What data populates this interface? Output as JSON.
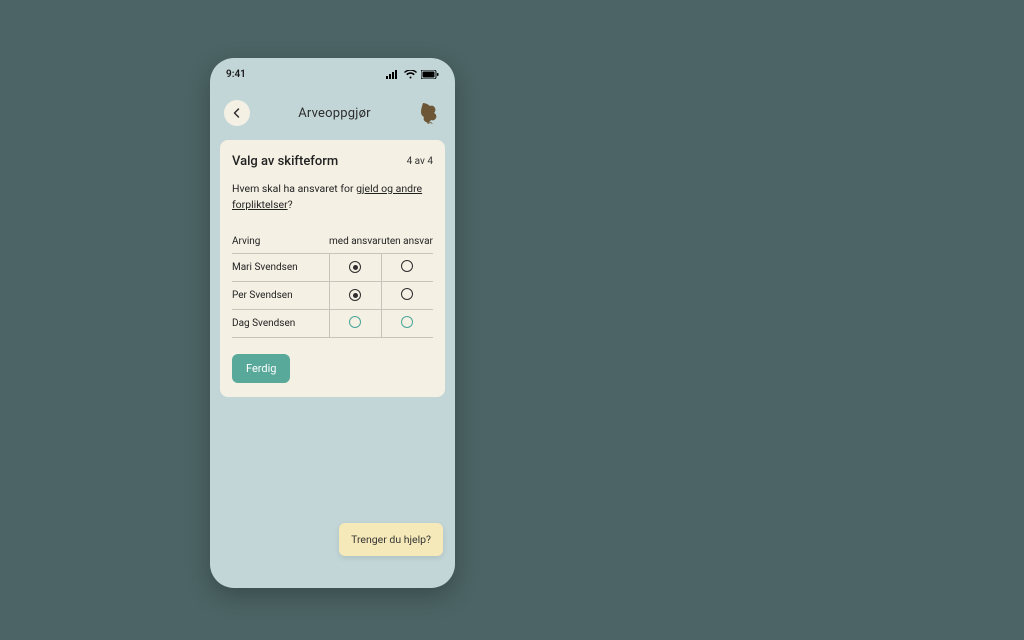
{
  "status": {
    "time": "9:41"
  },
  "header": {
    "title": "Arveoppgjør"
  },
  "card": {
    "title": "Valg av skifteform",
    "step": "4 av 4",
    "question_prefix": "Hvem skal ha ansvaret for ",
    "question_link": "gjeld og andre forpliktelser",
    "question_suffix": "?",
    "col_heir": "Arving",
    "col_with": "med ansvar",
    "col_without": "uten ansvar",
    "rows": [
      {
        "name": "Mari Svendsen",
        "with": true,
        "without": false,
        "teal": false
      },
      {
        "name": "Per Svendsen",
        "with": true,
        "without": false,
        "teal": false
      },
      {
        "name": "Dag Svendsen",
        "with": false,
        "without": false,
        "teal": true
      }
    ],
    "done": "Ferdig"
  },
  "help": {
    "label": "Trenger du hjelp?"
  }
}
